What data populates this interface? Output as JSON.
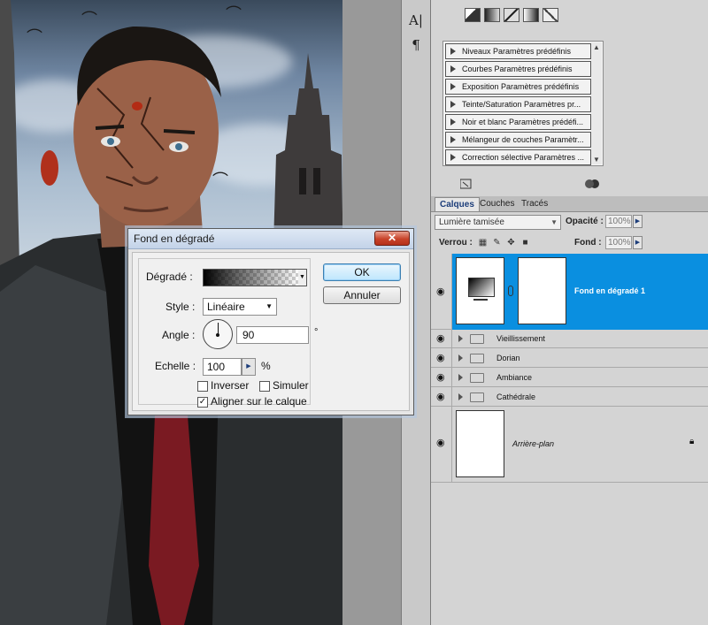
{
  "colors": {
    "accent": "#0a8fe0",
    "selected_layer": "#0a8fe0",
    "close_button": "#c8432a"
  },
  "toolstrip": {
    "tools": [
      {
        "icon": "character-icon",
        "glyph": "A|"
      },
      {
        "icon": "paragraph-icon",
        "glyph": "¶"
      }
    ]
  },
  "adjustments": {
    "presets": [
      "Niveaux Paramètres prédéfinis",
      "Courbes Paramètres prédéfinis",
      "Exposition Paramètres prédéfinis",
      "Teinte/Saturation Paramètres pr...",
      "Noir et blanc Paramètres prédéfi...",
      "Mélangeur de couches Paramètr...",
      "Correction sélective Paramètres ..."
    ]
  },
  "layers_panel": {
    "tabs": [
      "Calques",
      "Couches",
      "Tracés"
    ],
    "blend_mode": "Lumière tamisée",
    "opacity_label": "Opacité :",
    "opacity_value": "100%",
    "lock_label": "Verrou :",
    "fill_label": "Fond :",
    "fill_value": "100%",
    "layers": [
      {
        "name": "Fond en dégradé 1",
        "type": "adjustment",
        "selected": true
      },
      {
        "name": "Vieillissement",
        "type": "group"
      },
      {
        "name": "Dorian",
        "type": "group"
      },
      {
        "name": "Ambiance",
        "type": "group"
      },
      {
        "name": "Cathédrale",
        "type": "group"
      },
      {
        "name": "Arrière-plan",
        "type": "background",
        "locked": true
      }
    ]
  },
  "dialog": {
    "title": "Fond en dégradé",
    "close_glyph": "✕",
    "gradient_label": "Dégradé :",
    "style_label": "Style :",
    "style_value": "Linéaire",
    "angle_label": "Angle :",
    "angle_value": "90",
    "angle_unit": "°",
    "scale_label": "Echelle :",
    "scale_value": "100",
    "scale_unit": "%",
    "options": [
      {
        "label": "Inverser",
        "checked": false
      },
      {
        "label": "Simuler",
        "checked": false
      },
      {
        "label": "Aligner sur le calque",
        "checked": true
      }
    ],
    "ok_label": "OK",
    "cancel_label": "Annuler"
  }
}
